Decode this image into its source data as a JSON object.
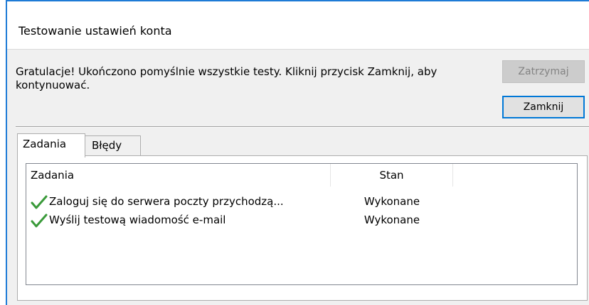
{
  "dialog": {
    "title": "Testowanie ustawień konta",
    "message": "Gratulacje! Ukończono pomyślnie wszystkie testy. Kliknij przycisk Zamknij, aby kontynuować.",
    "buttons": {
      "stop_label": "Zatrzymaj",
      "close_label": "Zamknij"
    },
    "tabs": [
      {
        "label": "Zadania",
        "active": true
      },
      {
        "label": "Błędy",
        "active": false
      }
    ],
    "task_list": {
      "columns": [
        "Zadania",
        "Stan"
      ],
      "rows": [
        {
          "task": "Zaloguj się do serwera poczty przychodzą...",
          "status": "Wykonane",
          "icon": "checkmark-icon"
        },
        {
          "task": "Wyślij testową wiadomość e-mail",
          "status": "Wykonane",
          "icon": "checkmark-icon"
        }
      ]
    },
    "colors": {
      "accent": "#0078d7",
      "check": "#3a9a3a"
    }
  }
}
